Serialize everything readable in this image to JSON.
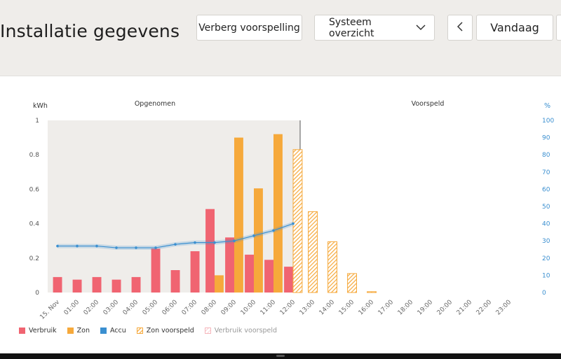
{
  "header": {
    "title": "Installatie gegevens",
    "hide_forecast_label": "Verberg voorspelling",
    "view_select_value": "Systeem overzicht",
    "today_label": "Vandaag"
  },
  "chart_data": {
    "type": "bar",
    "left_axis_label": "kWh",
    "right_axis_label": "%",
    "section_recorded": "Opgenomen",
    "section_forecast": "Voorspeld",
    "ylim": [
      0,
      1
    ],
    "y2lim": [
      0,
      100
    ],
    "y_ticks": [
      "0",
      "0.2",
      "0.4",
      "0.6",
      "0.8",
      "1"
    ],
    "y2_ticks": [
      "0",
      "10",
      "20",
      "30",
      "40",
      "50",
      "60",
      "70",
      "80",
      "90",
      "100"
    ],
    "categories": [
      "15. Nov",
      "01:00",
      "02:00",
      "03:00",
      "04:00",
      "05:00",
      "06:00",
      "07:00",
      "08:00",
      "09:00",
      "10:00",
      "11:00",
      "12:00",
      "13:00",
      "14:00",
      "15:00",
      "16:00",
      "17:00",
      "18:00",
      "19:00",
      "20:00",
      "21:00",
      "22:00",
      "23:00"
    ],
    "now_index": 12,
    "series": [
      {
        "name": "Verbruik",
        "kind": "bar",
        "color": "#f06471",
        "values": [
          0.09,
          0.075,
          0.09,
          0.075,
          0.09,
          0.255,
          0.13,
          0.24,
          0.485,
          0.32,
          0.22,
          0.19,
          0.15,
          null,
          null,
          null,
          null,
          null,
          null,
          null,
          null,
          null,
          null,
          null
        ]
      },
      {
        "name": "Zon",
        "kind": "bar",
        "color": "#f6a93b",
        "values": [
          null,
          null,
          null,
          null,
          null,
          null,
          null,
          null,
          0.1,
          0.9,
          0.605,
          0.92,
          0.605,
          null,
          null,
          null,
          null,
          null,
          null,
          null,
          null,
          null,
          null,
          null
        ]
      },
      {
        "name": "Accu",
        "kind": "line",
        "axis": "right",
        "color": "#3a8fd0",
        "values": [
          27,
          27,
          27,
          26,
          26,
          26,
          28,
          29,
          29,
          30,
          33,
          36,
          40,
          null,
          null,
          null,
          null,
          null,
          null,
          null,
          null,
          null,
          null,
          null
        ]
      },
      {
        "name": "Zon voorspeld",
        "kind": "hatched-bar",
        "color": "#f6a93b",
        "values": [
          null,
          null,
          null,
          null,
          null,
          null,
          null,
          null,
          null,
          null,
          null,
          null,
          0.83,
          0.47,
          0.295,
          0.11,
          0.005,
          null,
          null,
          null,
          null,
          null,
          null,
          null
        ]
      },
      {
        "name": "Verbruik voorspeld",
        "kind": "hatched-bar",
        "color": "#f06471",
        "values": [
          null,
          null,
          null,
          null,
          null,
          null,
          null,
          null,
          null,
          null,
          null,
          null,
          null,
          null,
          null,
          null,
          null,
          null,
          null,
          null,
          null,
          null,
          null,
          null
        ]
      }
    ]
  }
}
